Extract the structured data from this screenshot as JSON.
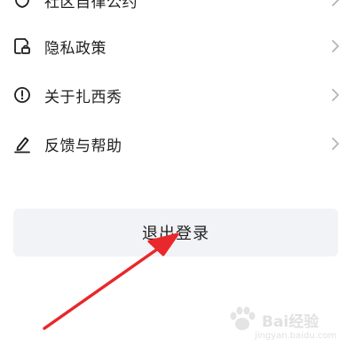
{
  "menu": {
    "items": [
      {
        "label": "社区自律公约",
        "icon": "shield-icon"
      },
      {
        "label": "隐私政策",
        "icon": "privacy-lock-icon"
      },
      {
        "label": "关于扎西秀",
        "icon": "info-icon"
      },
      {
        "label": "反馈与帮助",
        "icon": "edit-pen-icon"
      }
    ]
  },
  "logout": {
    "label": "退出登录"
  },
  "watermark": {
    "brand": "Bai",
    "brand2": "经验",
    "url": "jingyan.baidu.com"
  },
  "colors": {
    "arrow": "#e8282b",
    "button_bg": "#f2f3f6",
    "text": "#1f1f1f",
    "chevron": "#b5b5b5"
  }
}
